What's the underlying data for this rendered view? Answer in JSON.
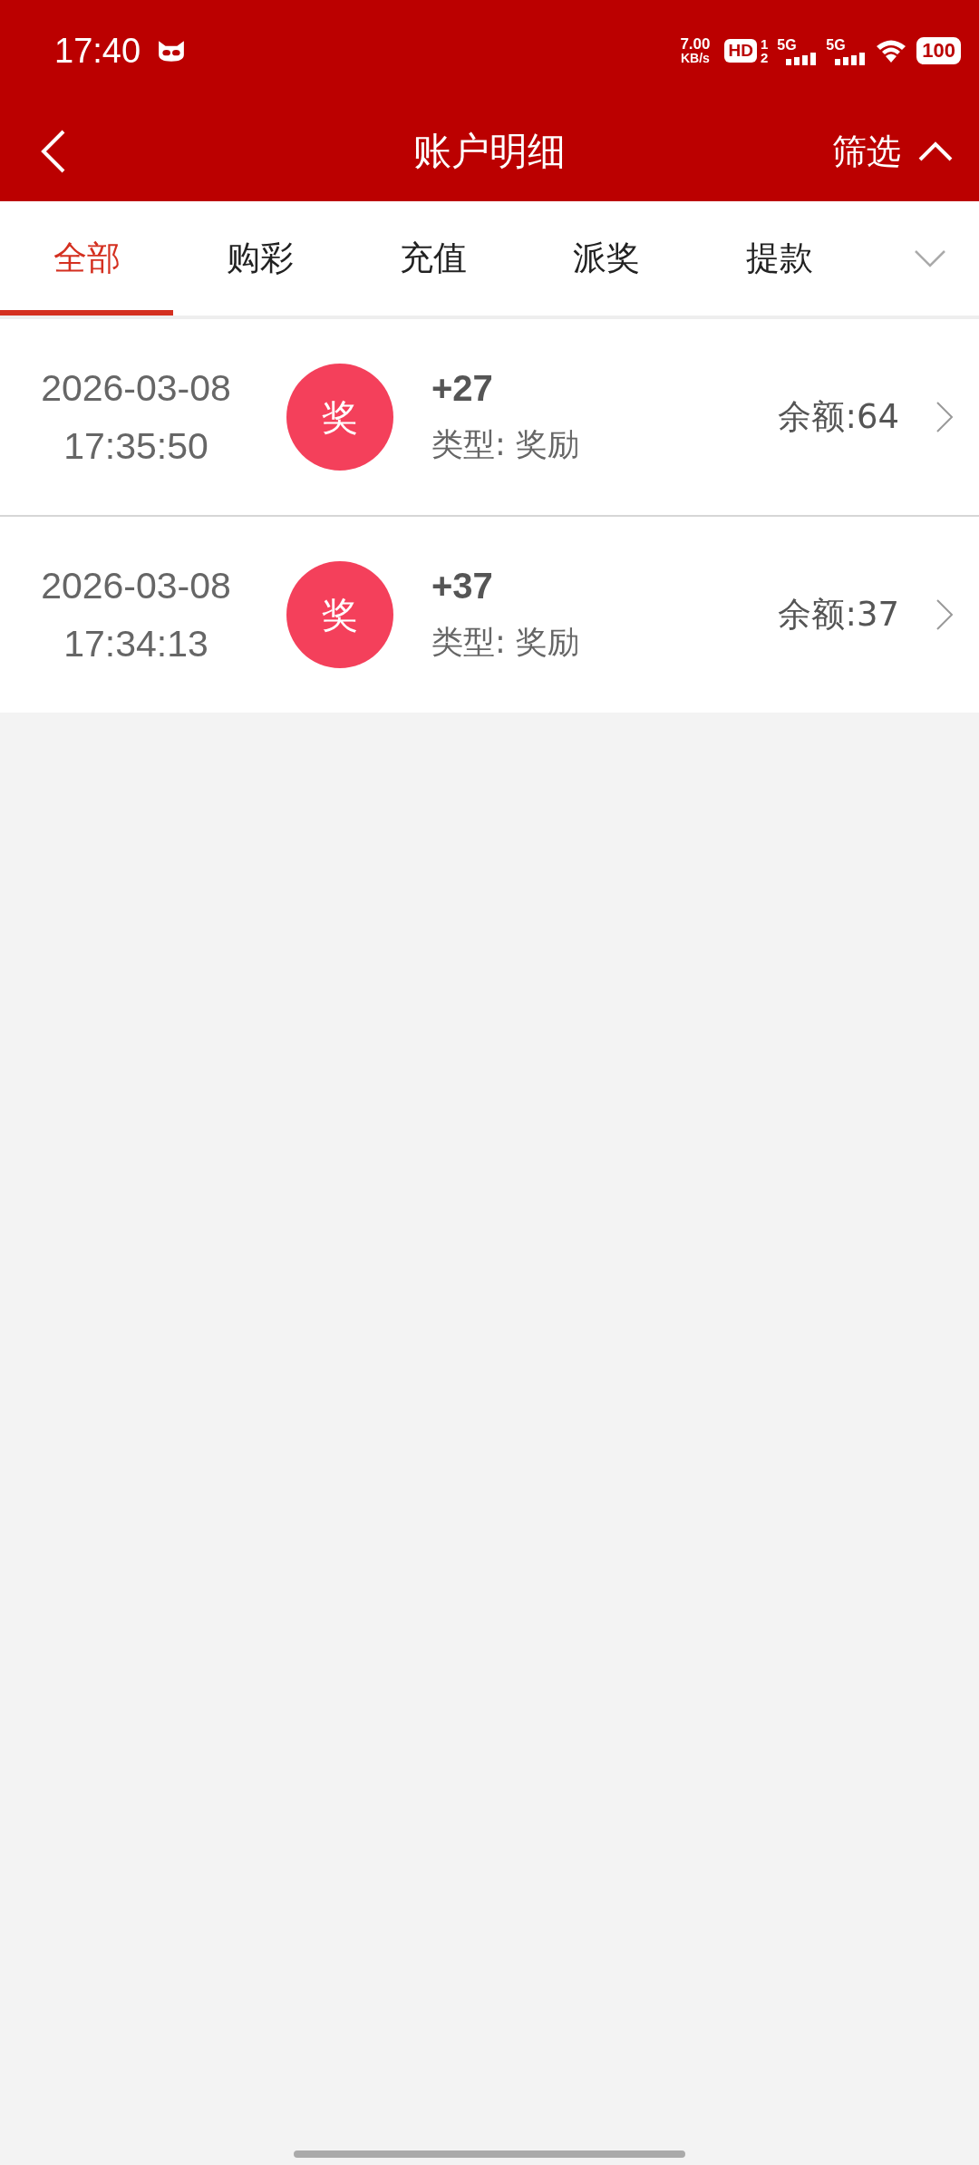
{
  "status_bar": {
    "time": "17:40",
    "net_speed": "7.00",
    "net_unit": "KB/s",
    "hd": "HD",
    "sim_slots": [
      "1",
      "2"
    ],
    "networks": [
      "5G",
      "5G"
    ],
    "battery": "100"
  },
  "header": {
    "title": "账户明细",
    "filter": "筛选"
  },
  "tabs": [
    {
      "label": "全部",
      "selected": true
    },
    {
      "label": "购彩",
      "selected": false
    },
    {
      "label": "充值",
      "selected": false
    },
    {
      "label": "派奖",
      "selected": false
    },
    {
      "label": "提款",
      "selected": false
    }
  ],
  "records": [
    {
      "date": "2026-03-08",
      "time": "17:35:50",
      "badge": "奖",
      "amount": "+27",
      "type": "类型: 奖励",
      "balance": "余额:64"
    },
    {
      "date": "2026-03-08",
      "time": "17:34:13",
      "badge": "奖",
      "amount": "+37",
      "type": "类型: 奖励",
      "balance": "余额:37"
    }
  ]
}
